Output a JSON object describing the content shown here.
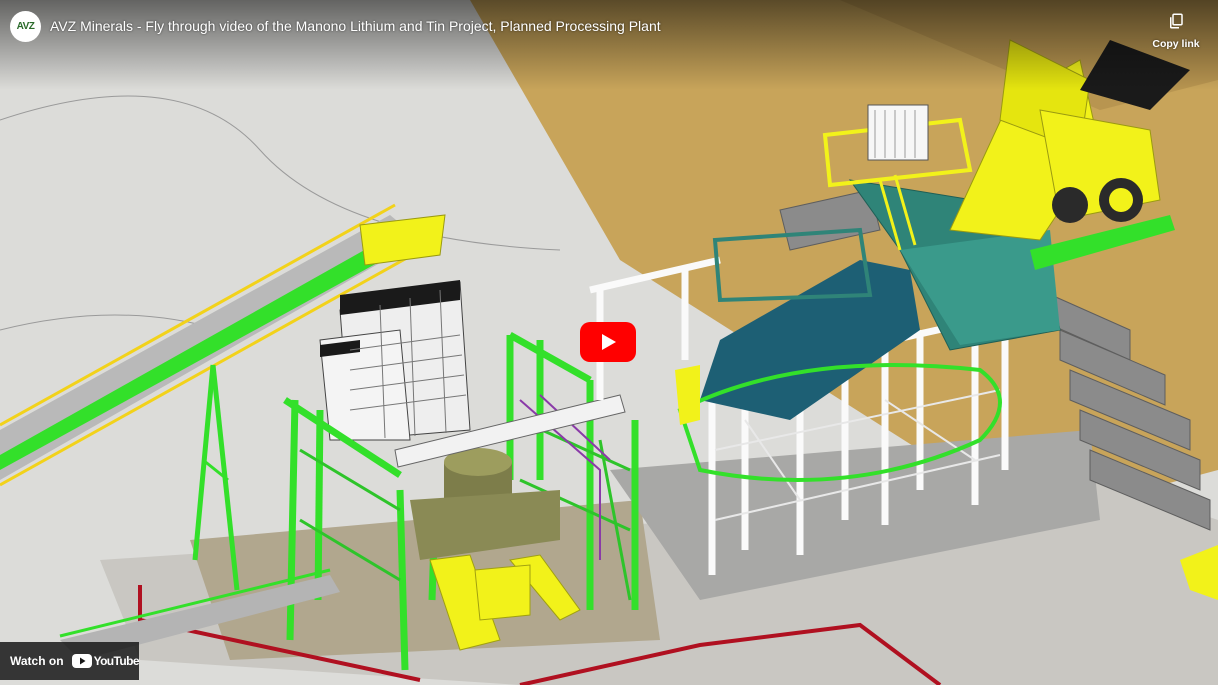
{
  "video": {
    "title": "AVZ Minerals - Fly through video of the Manono Lithium and Tin Project, Planned Processing Plant",
    "channel_avatar_text": "AVZ"
  },
  "controls": {
    "copy_link_label": "Copy link",
    "watch_on_label": "Watch on",
    "youtube_wordmark": "YouTube"
  },
  "icons": {
    "copy": "copy-icon",
    "play": "play-icon",
    "youtube": "youtube-logo-icon"
  },
  "colors": {
    "play_red": "#ff0000",
    "steel_green": "#33e02a",
    "hopper_teal": "#2f8478",
    "truck_yellow": "#f2f21a",
    "ground_tan": "#c8a45a"
  }
}
